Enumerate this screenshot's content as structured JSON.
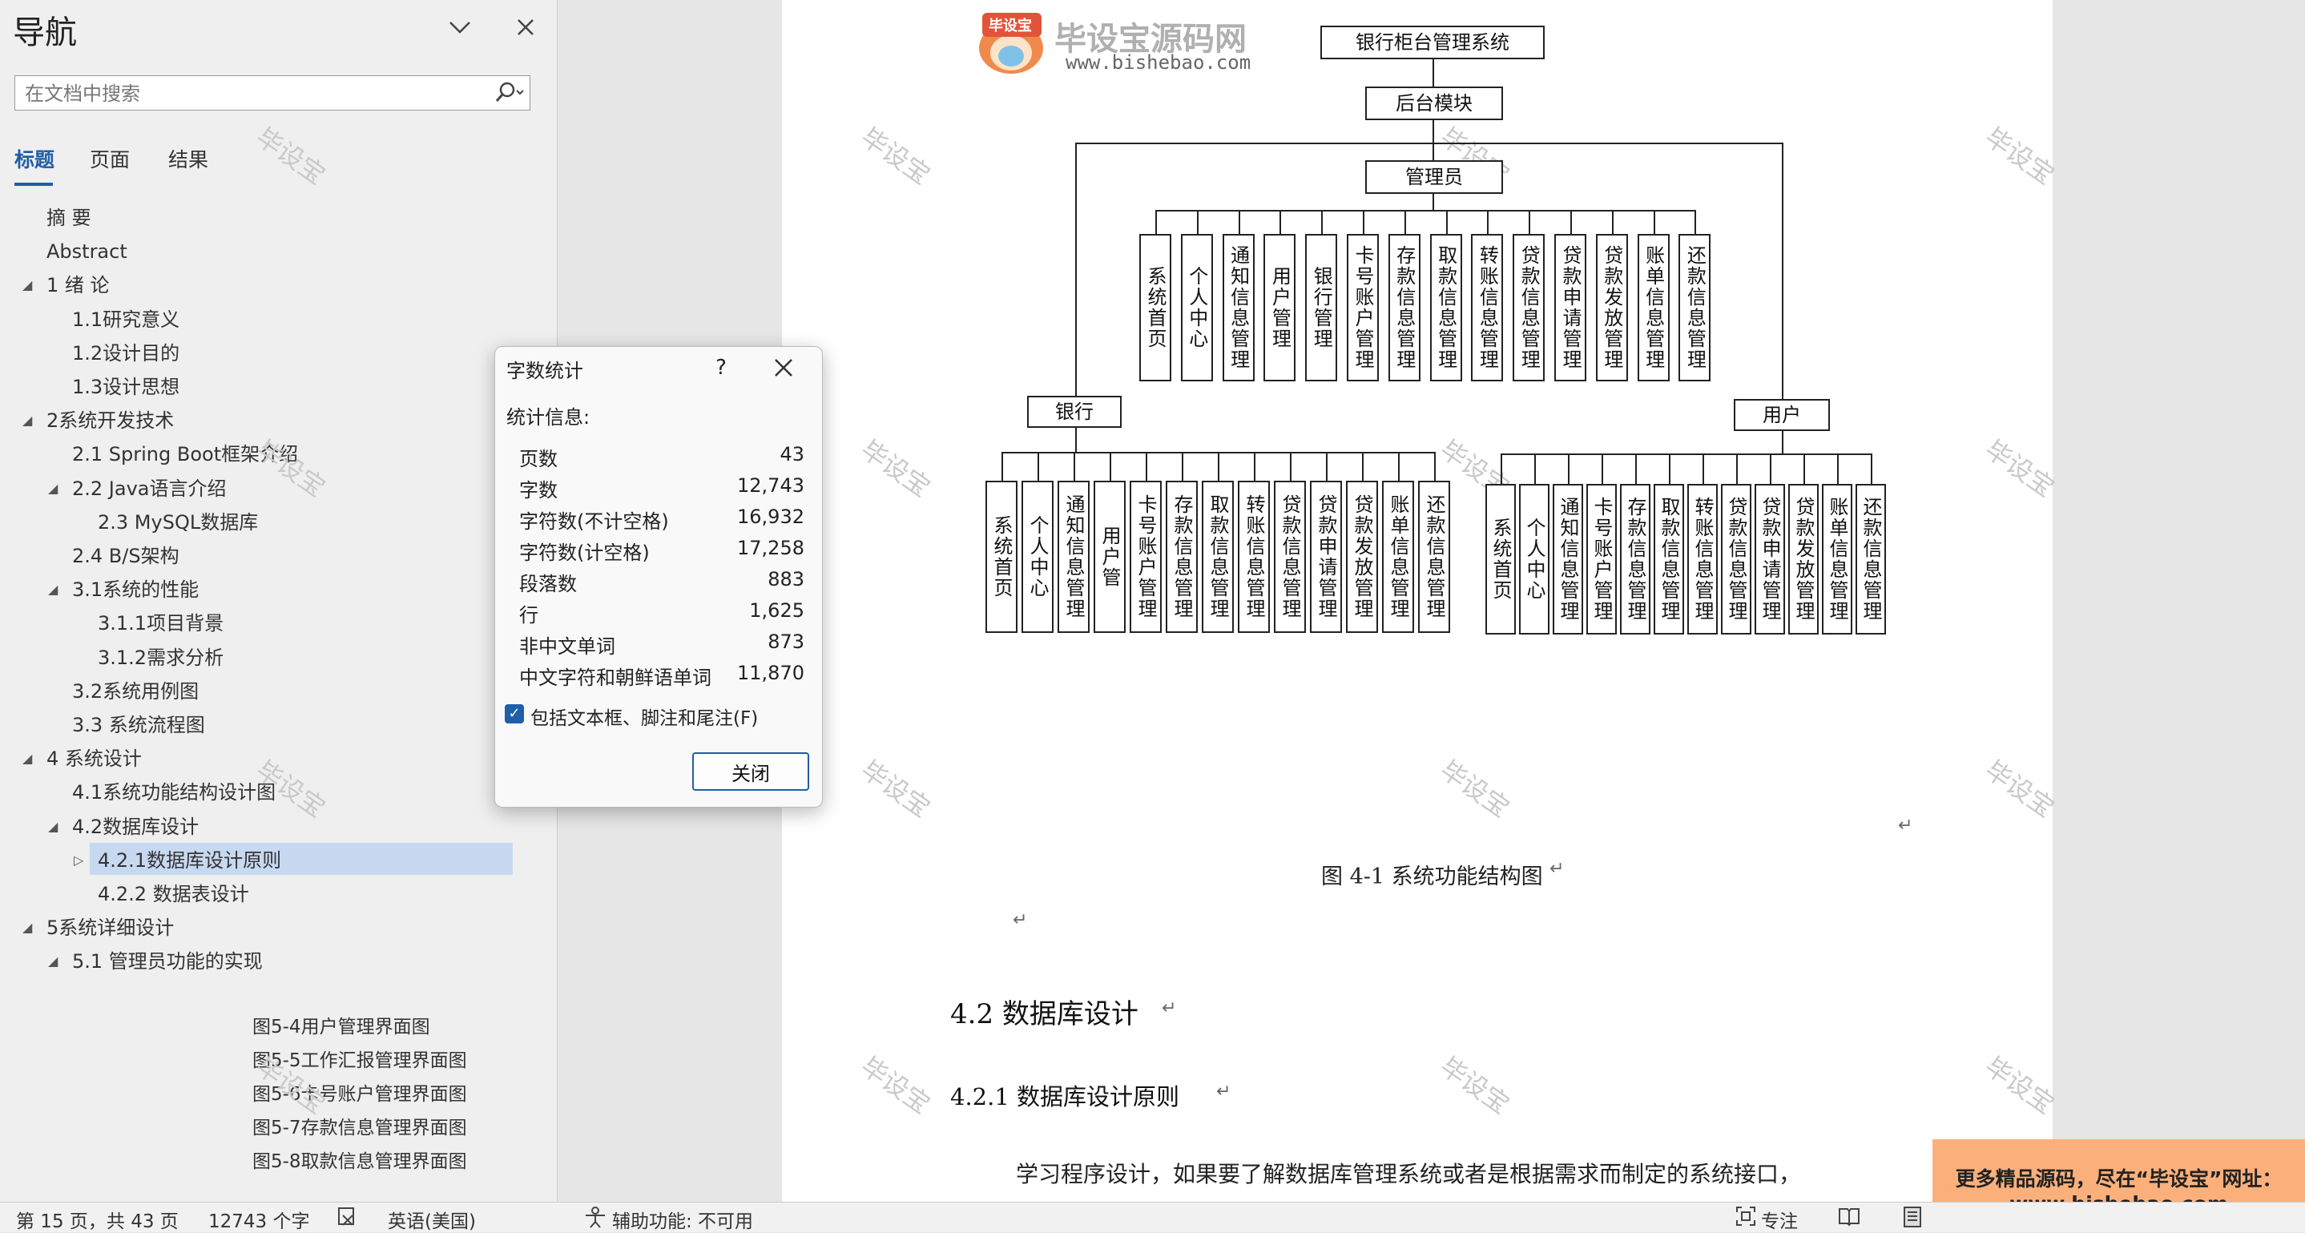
{
  "nav": {
    "title": "导航",
    "search_placeholder": "在文档中搜索",
    "tabs": [
      "标题",
      "页面",
      "结果"
    ],
    "tree": [
      {
        "label": "摘  要",
        "level": 1,
        "toggle": ""
      },
      {
        "label": "Abstract",
        "level": 1,
        "toggle": ""
      },
      {
        "label": "1 绪  论",
        "level": 0,
        "toggle": "◢"
      },
      {
        "label": "1.1研究意义",
        "level": 2,
        "toggle": ""
      },
      {
        "label": "1.2设计目的",
        "level": 2,
        "toggle": ""
      },
      {
        "label": "1.3设计思想",
        "level": 2,
        "toggle": ""
      },
      {
        "label": "2系统开发技术",
        "level": 0,
        "toggle": "◢"
      },
      {
        "label": "2.1 Spring Boot框架介绍",
        "level": 2,
        "toggle": ""
      },
      {
        "label": "2.2 Java语言介绍",
        "level": 1,
        "toggle": "◢"
      },
      {
        "label": "2.3 MySQL数据库",
        "level": 3,
        "toggle": ""
      },
      {
        "label": "2.4 B/S架构",
        "level": 2,
        "toggle": ""
      },
      {
        "label": "3.1系统的性能",
        "level": 1,
        "toggle": "◢"
      },
      {
        "label": "3.1.1项目背景",
        "level": 3,
        "toggle": ""
      },
      {
        "label": "3.1.2需求分析",
        "level": 3,
        "toggle": ""
      },
      {
        "label": "3.2系统用例图",
        "level": 2,
        "toggle": ""
      },
      {
        "label": "3.3 系统流程图",
        "level": 2,
        "toggle": ""
      },
      {
        "label": "4 系统设计",
        "level": 0,
        "toggle": "◢"
      },
      {
        "label": "4.1系统功能结构设计图",
        "level": 2,
        "toggle": ""
      },
      {
        "label": "4.2数据库设计",
        "level": 1,
        "toggle": "◢"
      },
      {
        "label": "4.2.1数据库设计原则",
        "level": 3,
        "toggle": "▷"
      },
      {
        "label": "4.2.2  数据表设计",
        "level": 3,
        "toggle": ""
      },
      {
        "label": "5系统详细设计",
        "level": 0,
        "toggle": "◢"
      },
      {
        "label": "5.1 管理员功能的实现",
        "level": 1,
        "toggle": "◢"
      }
    ],
    "figures": [
      "图5-4用户管理界面图",
      "图5-5工作汇报管理界面图",
      "图5-6卡号账户管理界面图",
      "图5-7存款信息管理界面图",
      "图5-8取款信息管理界面图"
    ]
  },
  "status": {
    "page": "第 15 页，共 43 页",
    "words": "12743 个字",
    "language": "英语(美国)",
    "accessibility": "辅助功能: 不可用",
    "focus": "专注"
  },
  "dialog": {
    "title": "字数统计",
    "help": "?",
    "subtitle": "统计信息:",
    "rows": [
      {
        "label": "页数",
        "value": "43"
      },
      {
        "label": "字数",
        "value": "12,743"
      },
      {
        "label": "字符数(不计空格)",
        "value": "16,932"
      },
      {
        "label": "字符数(计空格)",
        "value": "17,258"
      },
      {
        "label": "段落数",
        "value": "883"
      },
      {
        "label": "行",
        "value": "1,625"
      },
      {
        "label": "非中文单词",
        "value": "873"
      },
      {
        "label": "中文字符和朝鲜语单词",
        "value": "11,870"
      }
    ],
    "checkbox_label": "包括文本框、脚注和尾注(F)",
    "checkbox_checked": true,
    "close_label": "关闭"
  },
  "document": {
    "logo_text": "毕设宝源码网",
    "logo_badge": "毕设宝",
    "logo_url": "www.bishebao.com",
    "watermark": "毕设宝",
    "diagram": {
      "root": "银行柜台管理系统",
      "backend": "后台模块",
      "admin": "管理员",
      "admin_children": [
        "系统首页",
        "个人中心",
        "通知信息管理",
        "用户管理",
        "银行管理",
        "卡号账户管理",
        "存款信息管理",
        "取款信息管理",
        "转账信息管理",
        "贷款信息管理",
        "贷款申请管理",
        "贷款发放管理",
        "账单信息管理",
        "还款信息管理"
      ],
      "bank": "银行",
      "bank_children": [
        "系统首页",
        "个人中心",
        "通知信息管理",
        "用户管",
        "卡号账户管理",
        "存款信息管理",
        "取款信息管理",
        "转账信息管理",
        "贷款信息管理",
        "贷款申请管理",
        "贷款发放管理",
        "账单信息管理",
        "还款信息管理"
      ],
      "user": "用户",
      "user_children": [
        "系统首页",
        "个人中心",
        "通知信息管理",
        "卡号账户管理",
        "存款信息管理",
        "取款信息管理",
        "转账信息管理",
        "贷款信息管理",
        "贷款申请管理",
        "贷款发放管理",
        "账单信息管理",
        "还款信息管理"
      ]
    },
    "caption": "图 4-1 系统功能结构图",
    "heading_2": "4.2 数据库设计",
    "heading_3": "4.2.1 数据库设计原则",
    "paragraph": "学习程序设计，如果要了解数据库管理系统或者是根据需求而制定的系统接口，",
    "para_mark": "↵"
  },
  "promo": {
    "line1": "更多精品源码，尽在“毕设宝”网址：",
    "line2": "www.bishebao.com"
  }
}
